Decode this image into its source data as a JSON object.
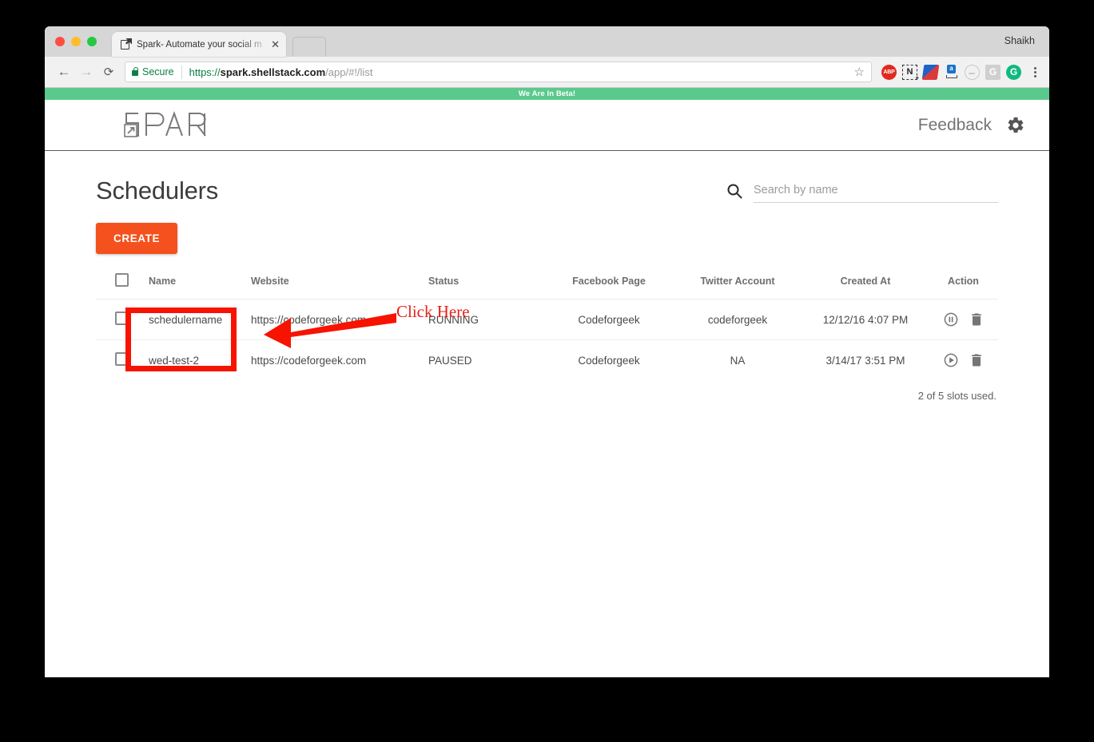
{
  "browser": {
    "profile_name": "Shaikh",
    "tab": {
      "title": "Spark- Automate your social m",
      "close_label": "✕",
      "favicon_name": "spark-favicon"
    },
    "nav": {
      "back_label": "←",
      "forward_label": "→",
      "reload_label": "⟳"
    },
    "omnibox": {
      "security_label": "Secure",
      "url_scheme": "https://",
      "url_host": "spark.shellstack.com",
      "url_path": "/app/#!/list",
      "bookmark_label": "☆"
    },
    "extensions": [
      {
        "name": "adblock-plus-extension",
        "label": "ABP"
      },
      {
        "name": "evernote-clipper-extension",
        "label": "N"
      },
      {
        "name": "pocket-extension",
        "label": ""
      },
      {
        "name": "grammarly-assistant-extension",
        "label": "a"
      },
      {
        "name": "generic-circle-extension",
        "label": ""
      },
      {
        "name": "google-extension-gray",
        "label": "G"
      },
      {
        "name": "grammarly-extension-green",
        "label": "G"
      }
    ]
  },
  "app": {
    "beta_banner": "We Are In Beta!",
    "logo_text": "SPARK",
    "feedback_label": "Feedback",
    "settings_icon": "gear-icon"
  },
  "main": {
    "page_title": "Schedulers",
    "search": {
      "placeholder": "Search by name",
      "value": ""
    },
    "create_button_label": "CREATE",
    "slots_text": "2 of 5 slots used."
  },
  "annotation": {
    "text": "Click Here",
    "color": "#e8201a",
    "target": "create-button"
  },
  "table": {
    "columns": [
      "Name",
      "Website",
      "Status",
      "Facebook Page",
      "Twitter Account",
      "Created At",
      "Action"
    ],
    "rows": [
      {
        "name": "schedulername",
        "website": "https://codeforgeek.com",
        "status": "RUNNING",
        "facebook_page": "Codeforgeek",
        "twitter_account": "codeforgeek",
        "created_at": "12/12/16 4:07 PM",
        "primary_action": "pause-circle-icon",
        "delete_action": "trash-icon"
      },
      {
        "name": "wed-test-2",
        "website": "https://codeforgeek.com",
        "status": "PAUSED",
        "facebook_page": "Codeforgeek",
        "twitter_account": "NA",
        "created_at": "3/14/17 3:51 PM",
        "primary_action": "play-circle-icon",
        "delete_action": "trash-icon"
      }
    ]
  },
  "colors": {
    "accent_orange": "#f4511e",
    "beta_green": "#5bc98d",
    "annotation_red": "#f71300",
    "secure_green": "#0b8043"
  }
}
